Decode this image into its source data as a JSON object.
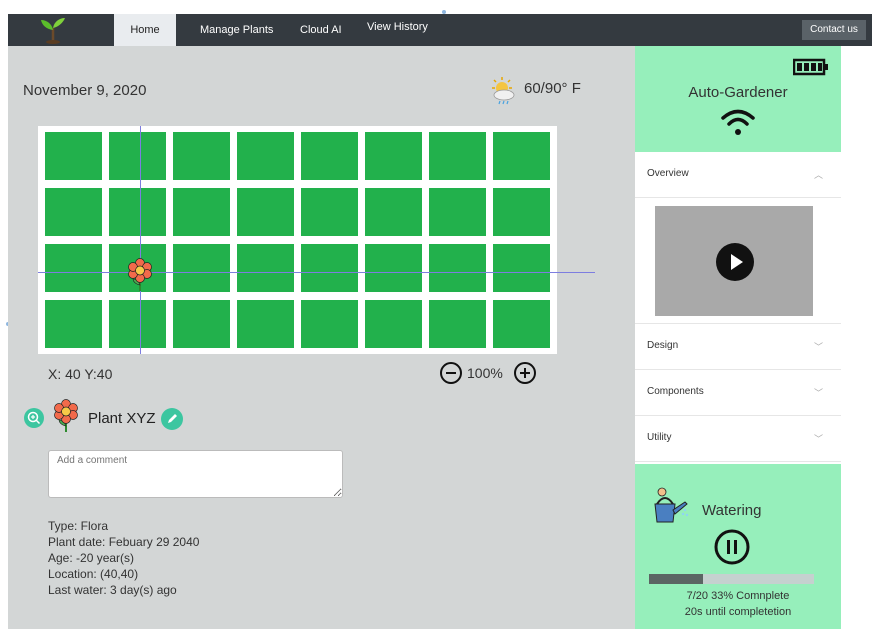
{
  "nav": {
    "items": [
      "Home",
      "Manage Plants",
      "Cloud AI",
      "View History"
    ],
    "active": "Home",
    "contact_label": "Contact us"
  },
  "main": {
    "date": "November 9, 2020",
    "weather": {
      "icon": "partly-cloudy-rain-icon",
      "text": "60/90° F"
    },
    "grid": {
      "rows": 4,
      "cols": 8,
      "cell_color": "#22b14c",
      "plant_row": 3,
      "plant_col": 2
    },
    "coords_text": "X: 40 Y:40",
    "zoom_text": "100%",
    "plant_name": "Plant XYZ",
    "comment_placeholder": "Add a comment",
    "info": {
      "type": "Type: Flora",
      "plant_date": "Plant date: Febuary 29 2040",
      "age": "Age: -20 year(s)",
      "location": "Location: (40,40)",
      "last_water": "Last water: 3 day(s) ago"
    }
  },
  "sidebar": {
    "title": "Auto-Gardener",
    "sections": [
      {
        "label": "Overview",
        "expanded": true
      },
      {
        "label": "Design",
        "expanded": false
      },
      {
        "label": "Components",
        "expanded": false
      },
      {
        "label": "Utility",
        "expanded": false
      }
    ],
    "watering": {
      "label": "Watering",
      "progress": 0.33,
      "status_line1": "7/20 33% Comnplete",
      "status_line2": "20s until completetion"
    }
  },
  "colors": {
    "topbar": "#343a40",
    "main_bg": "#d3d6d6",
    "accent_green": "#96efbb",
    "plant_green": "#22b14c",
    "teal_button": "#3cc6a0"
  }
}
